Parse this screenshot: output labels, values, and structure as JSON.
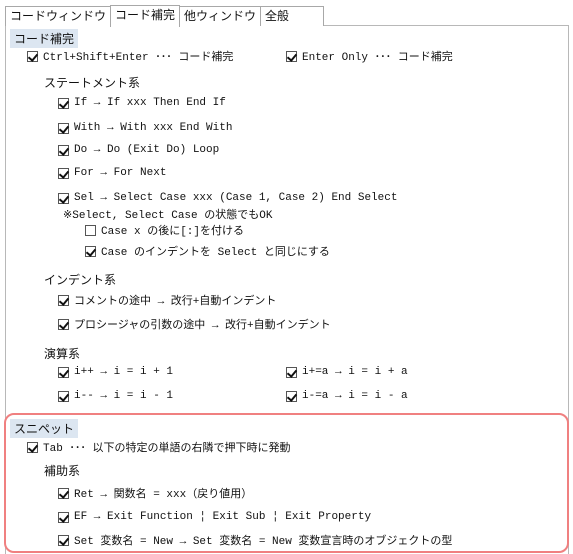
{
  "tabs": [
    "コードウィンドウ",
    "コード補完",
    "他ウィンドウ",
    "全般"
  ],
  "active_tab": "コード補完",
  "code_completion": {
    "header": "コード補完",
    "ctrl_shift_enter": {
      "label": "Ctrl+Shift+Enter  ･･･ コード補完",
      "checked": true
    },
    "enter_only": {
      "label": "Enter Only  ･･･ コード補完",
      "checked": true
    },
    "statement_group": "ステートメント系",
    "statements": [
      {
        "label": "If → If xxx Then End If",
        "checked": true
      },
      {
        "label": "With → With xxx End With",
        "checked": true
      },
      {
        "label": "Do → Do (Exit Do) Loop",
        "checked": true
      },
      {
        "label": "For → For Next",
        "checked": true
      },
      {
        "label": "Sel → Select Case xxx (Case 1, Case 2) End Select",
        "checked": true
      }
    ],
    "select_note": "※Select, Select Case の状態でもOK",
    "case_colon": {
      "label": "Case x の後に[:]を付ける",
      "checked": false
    },
    "case_indent": {
      "label": "Case のインデントを Select と同じにする",
      "checked": true
    },
    "indent_group": "インデント系",
    "indents": [
      {
        "label": "コメントの途中 → 改行+自動インデント",
        "checked": true
      },
      {
        "label": "プロシージャの引数の途中 → 改行+自動インデント",
        "checked": true
      }
    ],
    "operator_group": "演算系",
    "operators": [
      {
        "label": "i++ → i = i + 1",
        "checked": true
      },
      {
        "label": "i+=a → i = i + a",
        "checked": true
      },
      {
        "label": "i-- → i = i - 1",
        "checked": true
      },
      {
        "label": "i-=a → i = i - a",
        "checked": true
      }
    ]
  },
  "snippet": {
    "header": "スニペット",
    "tab": {
      "label": "Tab  ･･･ 以下の特定の単語の右隣で押下時に発動",
      "checked": true
    },
    "helper_group": "補助系",
    "items": [
      {
        "label": "Ret → 関数名 = xxx（戻り値用）",
        "checked": true
      },
      {
        "label": "EF → Exit Function ¦ Exit Sub ¦ Exit Property",
        "checked": true
      },
      {
        "label": "Set 変数名 = New → Set 変数名 = New 変数宣言時のオブジェクトの型",
        "checked": true
      }
    ]
  },
  "colors": {
    "highlight_border": "#f08080",
    "header_bg": "#dce6f1"
  }
}
